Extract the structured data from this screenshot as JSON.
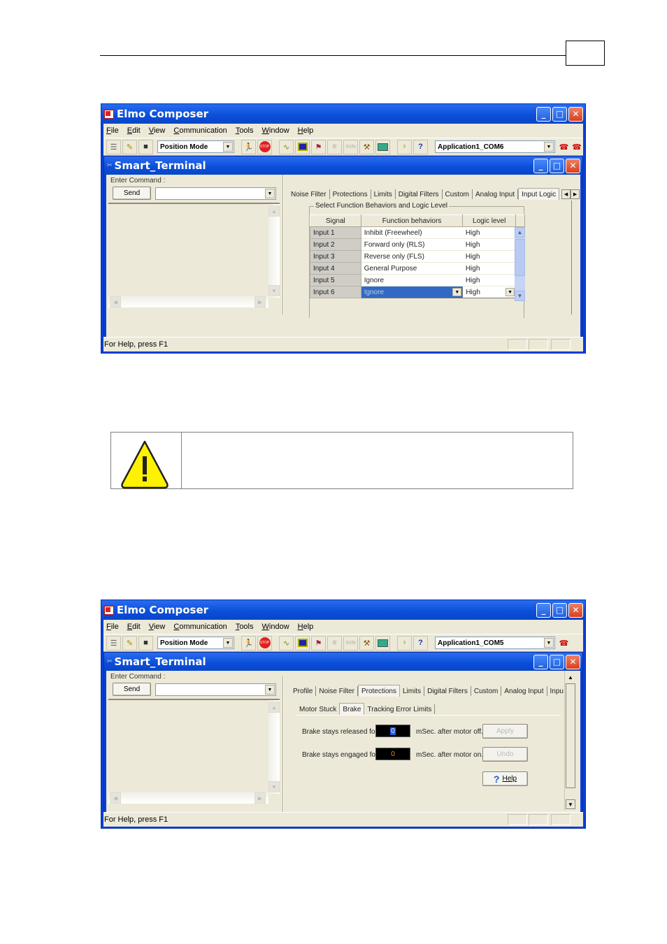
{
  "page_header": {
    "page_number": ""
  },
  "screenshot1": {
    "app_title": "Elmo Composer",
    "menu": [
      "File",
      "Edit",
      "View",
      "Communication",
      "Tools",
      "Window",
      "Help"
    ],
    "toolbar": {
      "mode_combo": "Position Mode",
      "app_combo": "Application1_COM6",
      "disabled_button_label": "SVN",
      "stop_label": "STOP"
    },
    "child_title": "Smart_Terminal",
    "enter_command_label": "Enter Command :",
    "send_label": "Send",
    "command_value": "",
    "tabs": [
      "Noise Filter",
      "Protections",
      "Limits",
      "Digital Filters",
      "Custom",
      "Analog Input",
      "Input Logic"
    ],
    "active_tab": "Input Logic",
    "groupbox_title": "Select Function Behaviors and Logic Level",
    "grid": {
      "headers": [
        "Signal",
        "Function behaviors",
        "Logic level"
      ],
      "rows": [
        {
          "signal": "Input 1",
          "behavior": "Inhibit (Freewheel)",
          "level": "High"
        },
        {
          "signal": "Input 2",
          "behavior": "Forward only (RLS)",
          "level": "High"
        },
        {
          "signal": "Input 3",
          "behavior": "Reverse only (FLS)",
          "level": "High"
        },
        {
          "signal": "Input 4",
          "behavior": "General Purpose",
          "level": "High"
        },
        {
          "signal": "Input 5",
          "behavior": "Ignore",
          "level": "High"
        },
        {
          "signal": "Input 6",
          "behavior": "Ignore",
          "level": "High"
        }
      ]
    },
    "status": "For Help, press F1"
  },
  "caution_box": {
    "icon": "warning-triangle-icon",
    "text": ""
  },
  "screenshot2": {
    "app_title": "Elmo Composer",
    "menu": [
      "File",
      "Edit",
      "View",
      "Communication",
      "Tools",
      "Window",
      "Help"
    ],
    "toolbar": {
      "mode_combo": "Position Mode",
      "app_combo": "Application1_COM5",
      "disabled_button_label": "SVN",
      "stop_label": "STOP"
    },
    "child_title": "Smart_Terminal",
    "enter_command_label": "Enter Command :",
    "send_label": "Send",
    "command_value": "",
    "tabs": [
      "Profile",
      "Noise Filter",
      "Protections",
      "Limits",
      "Digital Filters",
      "Custom",
      "Analog Input",
      "Inpu"
    ],
    "active_tab": "Protections",
    "subtabs": [
      "Motor Stuck",
      "Brake",
      "Tracking Error Limits"
    ],
    "active_subtab": "Brake",
    "brake": {
      "released_label": "Brake stays released for",
      "released_value": "0",
      "released_unit": "mSec. after motor off.",
      "engaged_label": "Brake stays engaged for",
      "engaged_value": "0",
      "engaged_unit": "mSec. after motor on."
    },
    "buttons": {
      "apply": "Apply",
      "undo": "Undo",
      "help": "Help"
    },
    "status": "For Help, press F1"
  },
  "colors": {
    "titlebar": "#0a4ed8",
    "window_bg": "#ece9d8",
    "selection": "#316ac5",
    "warning_yellow": "#fff200",
    "lcd_blue_digit": "#4a7cff",
    "lcd_orange_digit": "#e08a20"
  }
}
